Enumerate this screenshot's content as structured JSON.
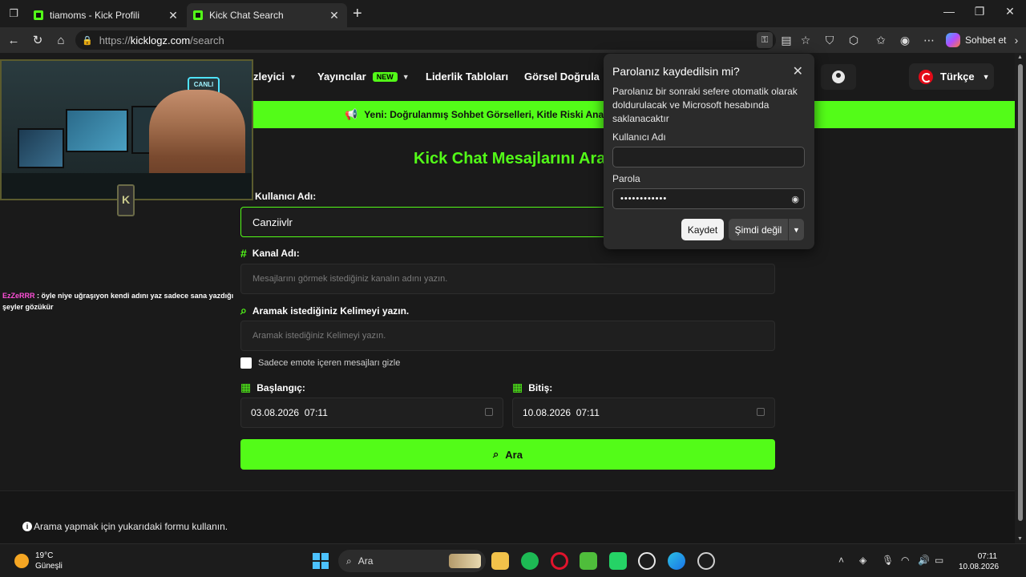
{
  "browser": {
    "tabs": [
      {
        "label": "tiamoms - Kick Profili",
        "close": "✕"
      },
      {
        "label": "Kick Chat Search",
        "close": "✕"
      }
    ],
    "new_tab": "+",
    "url_prefix": "https://",
    "url_host": "kicklogz.com",
    "url_path": "/search",
    "sohbet_label": "Sohbet et"
  },
  "nav": {
    "items": [
      {
        "label": "zleyici"
      },
      {
        "label": "Yayıncılar",
        "badge": "NEW"
      },
      {
        "label": "Liderlik Tabloları"
      },
      {
        "label": "Görsel Doğrula"
      }
    ],
    "language": "Türkçe"
  },
  "banner": {
    "text": "Yeni: Doğrulanmış Sohbet Görselleri, Kitle Riski Analizi"
  },
  "main": {
    "heading": "Kick Chat Mesajlarını Ara",
    "username_label": "Kullanıcı Adı:",
    "username_value": "Canziivlr",
    "channel_label": "Kanal Adı:",
    "channel_placeholder": "Mesajlarını görmek istediğiniz kanalın adını yazın.",
    "keyword_label": "Aramak istediğiniz Kelimeyi yazın.",
    "keyword_placeholder": "Aramak istediğiniz Kelimeyi yazın.",
    "emote_checkbox": "Sadece emote içeren mesajları gizle",
    "start_label": "Başlangıç:",
    "start_value": "03.08.2026  07:11",
    "end_label": "Bitiş:",
    "end_value": "10.08.2026  07:11",
    "search_button": "Ara",
    "info_text": "Arama yapmak için yukarıdaki formu kullanın."
  },
  "overlay": {
    "neon_sign": "CANLI YAYIN",
    "emblem": "K",
    "chat_user": "EzZeRRR",
    "chat_message": " : öyle niye uğraşıyon kendi adını yaz sadece sana yazdığı şeyler gözükür"
  },
  "password_popup": {
    "title": "Parolanız kaydedilsin mi?",
    "description": "Parolanız bir sonraki sefere otomatik olarak doldurulacak ve Microsoft hesabında saklanacaktır",
    "username_label": "Kullanıcı Adı",
    "username_value": "",
    "password_label": "Parola",
    "password_value": "••••••••••••",
    "save_button": "Kaydet",
    "not_now_button": "Şimdi değil"
  },
  "taskbar": {
    "temperature": "19°C",
    "weather": "Güneşli",
    "search_placeholder": "Ara",
    "time": "07:11",
    "date": "10.08.2026"
  },
  "colors": {
    "accent": "#53fc18",
    "background": "#1a1a1a"
  }
}
